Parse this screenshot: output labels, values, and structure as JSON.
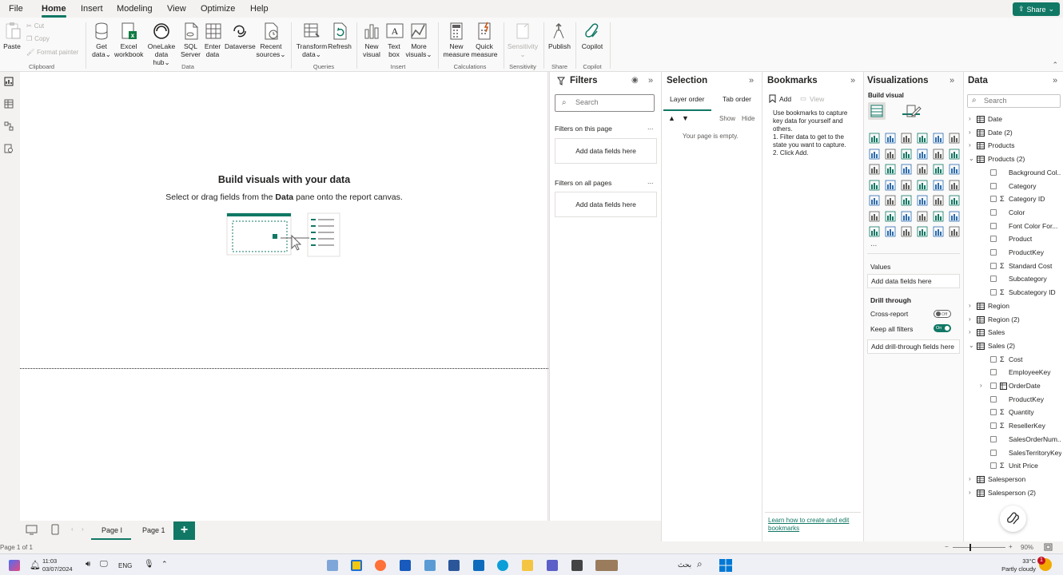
{
  "menu": {
    "tabs": [
      "File",
      "Home",
      "Insert",
      "Modeling",
      "View",
      "Optimize",
      "Help"
    ],
    "active": "Home",
    "share_label": "Share"
  },
  "ribbon": {
    "clipboard": {
      "paste": "Paste",
      "cut": "Cut",
      "copy": "Copy",
      "format_painter": "Format painter",
      "label": "Clipboard"
    },
    "data": {
      "get_data": [
        "Get",
        "data"
      ],
      "excel": [
        "Excel",
        "workbook"
      ],
      "onelake": [
        "OneLake",
        "data hub"
      ],
      "sql": [
        "SQL",
        "Server"
      ],
      "enter": [
        "Enter",
        "data"
      ],
      "dataverse": "Dataverse",
      "recent": [
        "Recent",
        "sources"
      ],
      "label": "Data"
    },
    "queries": {
      "transform": [
        "Transform",
        "data"
      ],
      "refresh": "Refresh",
      "label": "Queries"
    },
    "insert": {
      "new_visual": [
        "New",
        "visual"
      ],
      "text_box": [
        "Text",
        "box"
      ],
      "more_visuals": [
        "More",
        "visuals"
      ],
      "label": "Insert"
    },
    "calculations": {
      "new_measure": [
        "New",
        "measure"
      ],
      "quick_measure": [
        "Quick",
        "measure"
      ],
      "label": "Calculations"
    },
    "sensitivity": {
      "btn": "Sensitivity",
      "label": "Sensitivity"
    },
    "share": {
      "publish": "Publish",
      "label": "Share"
    },
    "copilot": {
      "btn": "Copilot",
      "label": "Copilot"
    }
  },
  "canvas": {
    "title": "Build visuals with your data",
    "subtitle_pre": "Select or drag fields from the ",
    "subtitle_bold": "Data",
    "subtitle_post": " pane onto the report canvas."
  },
  "pages": {
    "tabs": [
      "Page I",
      "Page 1"
    ],
    "active": "Page I",
    "add": "+"
  },
  "status": {
    "page_info": "Page 1 of 1",
    "zoom": "90%"
  },
  "filters": {
    "title": "Filters",
    "search_placeholder": "Search",
    "on_this_page": "Filters on this page",
    "on_all_pages": "Filters on all pages",
    "add_fields": "Add data fields here",
    "dots": "..."
  },
  "selection": {
    "title": "Selection",
    "tabs": [
      "Layer order",
      "Tab order"
    ],
    "show": "Show",
    "hide": "Hide",
    "empty": "Your page is empty."
  },
  "bookmarks": {
    "title": "Bookmarks",
    "add": "Add",
    "view": "View",
    "help_text": "Use bookmarks to capture key data for yourself and others.",
    "step1": "1. Filter data to get to the state you want to capture.",
    "step2": "2. Click Add.",
    "learn_link": "Learn how to create and edit bookmarks"
  },
  "visualizations": {
    "title": "Visualizations",
    "build_visual": "Build visual",
    "more": "...",
    "values_label": "Values",
    "values_well": "Add data fields here",
    "drill_through": "Drill through",
    "cross_report": "Cross-report",
    "cross_report_state": "Off",
    "keep_all_filters": "Keep all filters",
    "keep_all_state": "On",
    "drill_well": "Add drill-through fields here"
  },
  "data_pane": {
    "title": "Data",
    "search_placeholder": "Search",
    "tables": [
      {
        "name": "Date",
        "expanded": false
      },
      {
        "name": "Date (2)",
        "expanded": false
      },
      {
        "name": "Products",
        "expanded": false
      },
      {
        "name": "Products (2)",
        "expanded": true,
        "fields": [
          {
            "name": "Background Col...",
            "sigma": false
          },
          {
            "name": "Category",
            "sigma": false
          },
          {
            "name": "Category ID",
            "sigma": true
          },
          {
            "name": "Color",
            "sigma": false
          },
          {
            "name": "Font Color For...",
            "sigma": false
          },
          {
            "name": "Product",
            "sigma": false
          },
          {
            "name": "ProductKey",
            "sigma": false
          },
          {
            "name": "Standard Cost",
            "sigma": true
          },
          {
            "name": "Subcategory",
            "sigma": false
          },
          {
            "name": "Subcategory ID",
            "sigma": true
          }
        ]
      },
      {
        "name": "Region",
        "expanded": false
      },
      {
        "name": "Region (2)",
        "expanded": false
      },
      {
        "name": "Sales",
        "expanded": false
      },
      {
        "name": "Sales (2)",
        "expanded": true,
        "fields": [
          {
            "name": "Cost",
            "sigma": true
          },
          {
            "name": "EmployeeKey",
            "sigma": false
          },
          {
            "name": "OrderDate",
            "sigma": false,
            "hierarchy": true
          },
          {
            "name": "ProductKey",
            "sigma": false
          },
          {
            "name": "Quantity",
            "sigma": true
          },
          {
            "name": "ResellerKey",
            "sigma": true
          },
          {
            "name": "SalesOrderNum...",
            "sigma": false
          },
          {
            "name": "SalesTerritoryKey",
            "sigma": false
          },
          {
            "name": "Unit Price",
            "sigma": true
          }
        ]
      },
      {
        "name": "Salesperson",
        "expanded": false
      },
      {
        "name": "Salesperson (2)",
        "expanded": false
      }
    ]
  },
  "taskbar": {
    "time": "11:03",
    "date": "03/07/2024",
    "lang": "ENG",
    "search": "بحث",
    "weather_temp": "33°C",
    "weather_desc": "Partly cloudy",
    "notif_count": "1"
  }
}
